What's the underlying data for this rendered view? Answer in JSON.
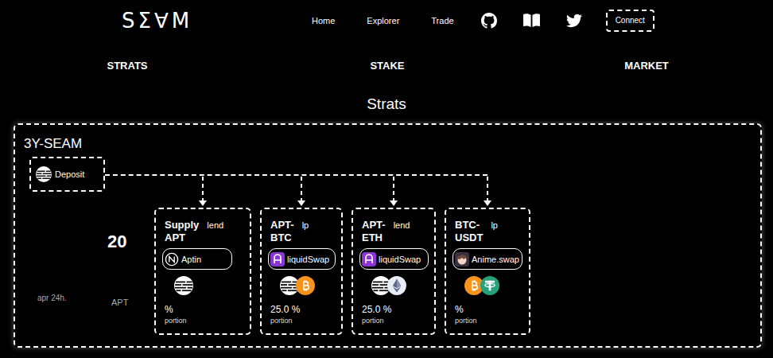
{
  "header": {
    "logo": "SΣ∀M",
    "nav": [
      {
        "label": "Home"
      },
      {
        "label": "Explorer"
      },
      {
        "label": "Trade"
      }
    ],
    "connect": "Connect"
  },
  "sections": [
    {
      "label": "STRATS"
    },
    {
      "label": "STAKE"
    },
    {
      "label": "MARKET"
    }
  ],
  "page_title": "Strats",
  "strategy": {
    "name": "3Y-SEAM",
    "deposit": "Deposit",
    "apr_value": "20",
    "apr_label": "apr 24h.",
    "apr_unit": "APT",
    "cards": [
      {
        "title": "Supply APT",
        "type": "lend",
        "protocol": {
          "name": "Aptin",
          "kind": "aptin"
        },
        "tokens": [
          {
            "kind": "apt"
          }
        ],
        "portion": "%",
        "portion_label": "portion"
      },
      {
        "title": "APT-BTC",
        "type": "lp",
        "protocol": {
          "name": "liquidSwap",
          "kind": "liquidswap"
        },
        "tokens": [
          {
            "kind": "apt"
          },
          {
            "kind": "btc"
          }
        ],
        "portion": "25.0 %",
        "portion_label": "portion"
      },
      {
        "title": "APT-ETH",
        "type": "lend",
        "protocol": {
          "name": "liquidSwap",
          "kind": "liquidswap"
        },
        "tokens": [
          {
            "kind": "apt"
          },
          {
            "kind": "eth"
          }
        ],
        "portion": "25.0 %",
        "portion_label": "portion"
      },
      {
        "title": "BTC-USDT",
        "type": "lp",
        "protocol": {
          "name": "Anime.swap",
          "kind": "anime"
        },
        "tokens": [
          {
            "kind": "btc"
          },
          {
            "kind": "usdt"
          }
        ],
        "portion": "%",
        "portion_label": "portion"
      }
    ]
  }
}
